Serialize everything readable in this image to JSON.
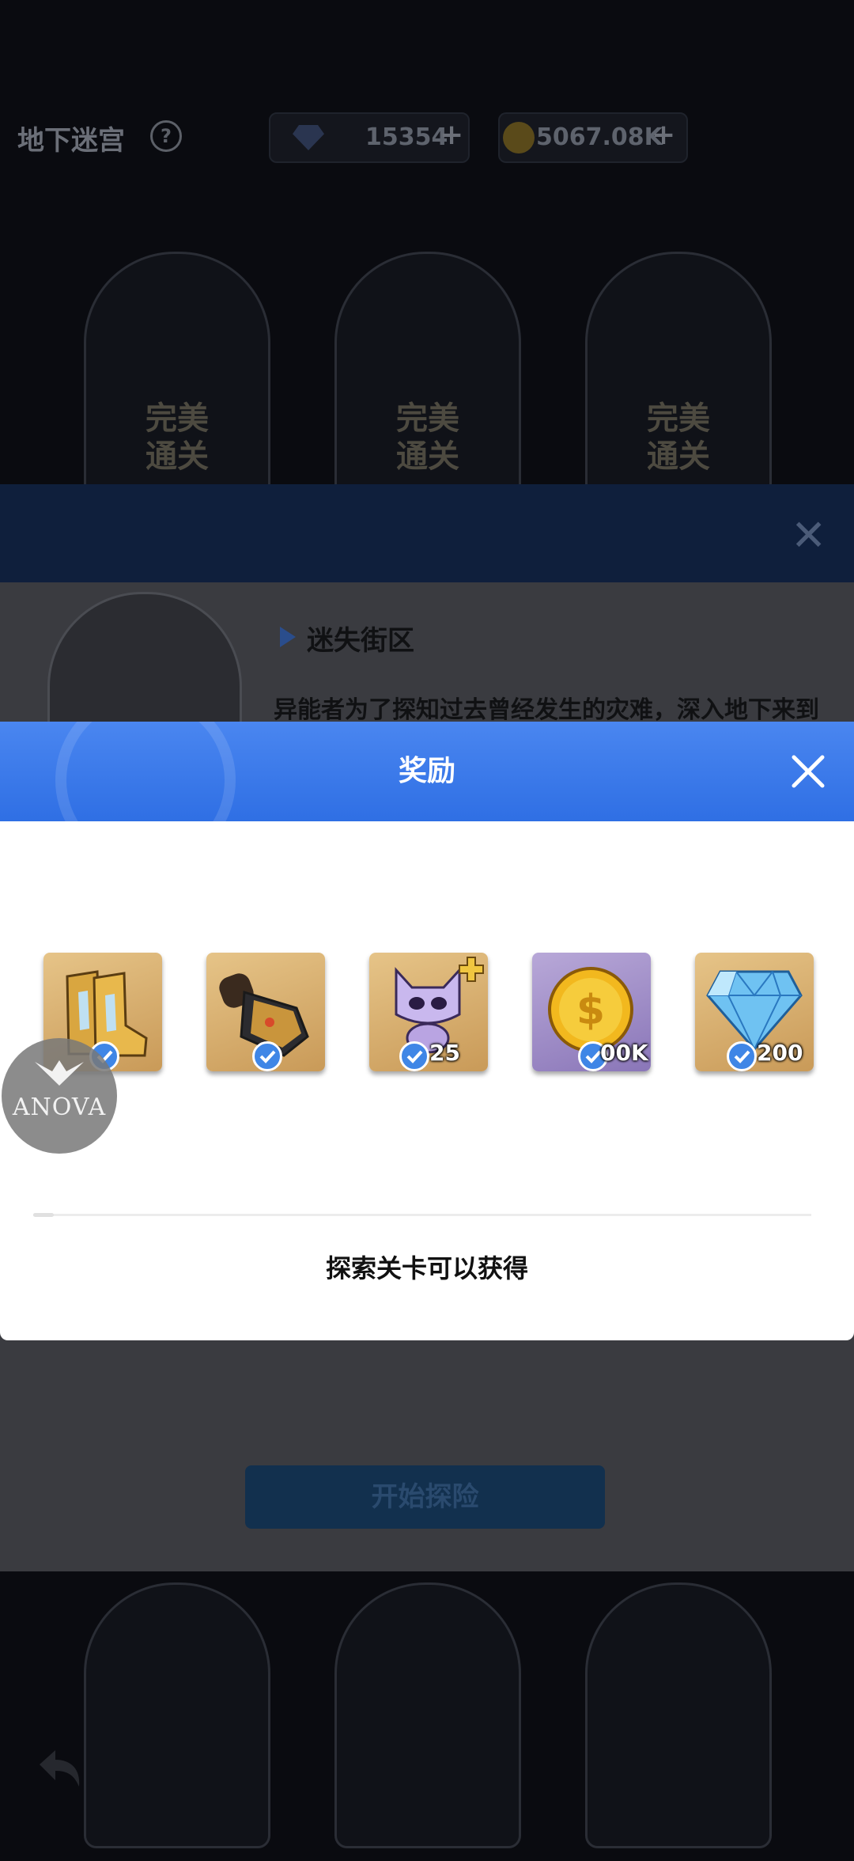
{
  "background": {
    "title": "地下迷宫",
    "help_icon": "?",
    "gems": "15354",
    "coins": "5067.08K",
    "plus": "+",
    "stage_badges": [
      "完美\n通关",
      "完美\n通关",
      "完美\n通关"
    ],
    "stage_name": "迷失街区",
    "stage_desc": "异能者为了探知过去曾经发生的灾难，深入地下来到",
    "start_button": "开始探险",
    "close_symbol": "✕"
  },
  "modal": {
    "title": "奖励",
    "caption": "探索关卡可以获得",
    "items": [
      {
        "name": "boots",
        "qty": ""
      },
      {
        "name": "gauntlet",
        "qty": ""
      },
      {
        "name": "robot-cat-pet",
        "qty": "25"
      },
      {
        "name": "gold-coin",
        "qty": "00K"
      },
      {
        "name": "diamond",
        "qty": "200"
      }
    ]
  },
  "watermark": "ANOVA",
  "colors": {
    "modal_header": "#3a78ea",
    "check": "#3f86e6"
  }
}
